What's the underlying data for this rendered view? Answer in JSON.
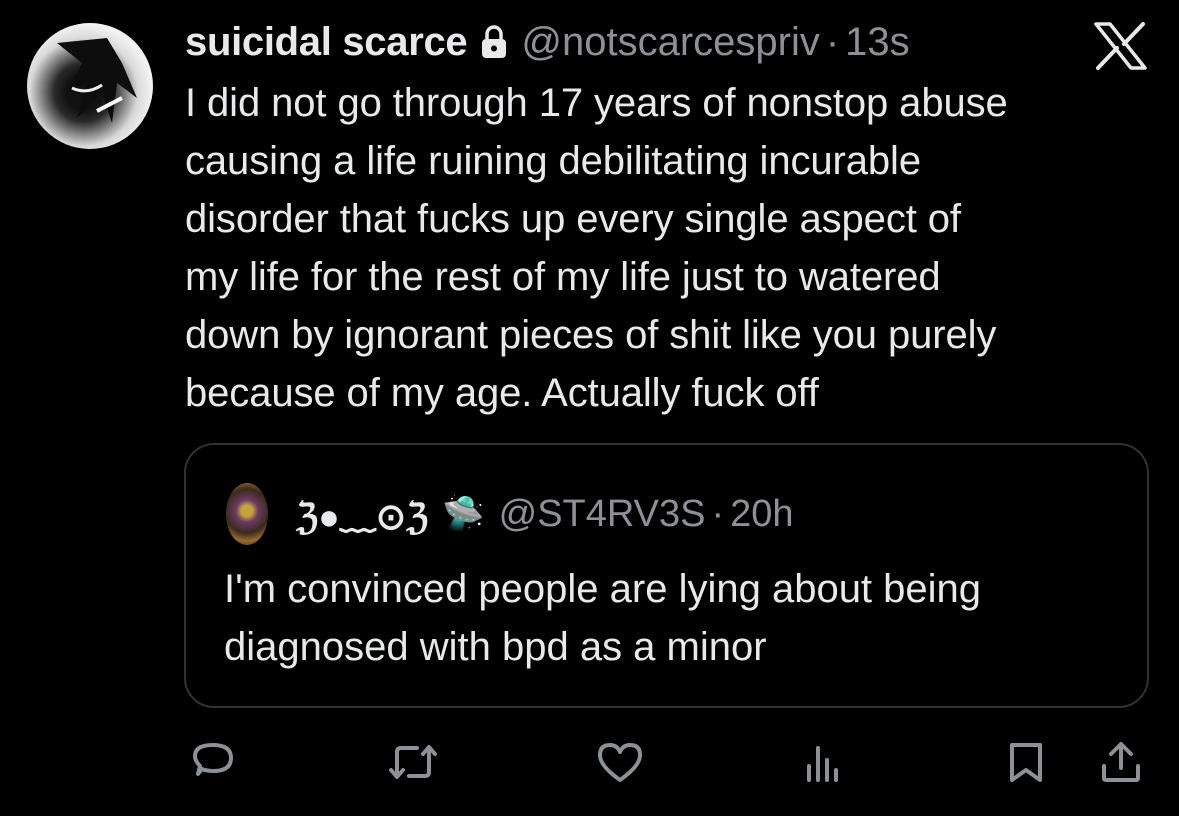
{
  "tweet": {
    "display_name": "suicidal scarce",
    "handle": "@notscarcespriv",
    "separator": "·",
    "time": "13s",
    "text": "I did not go through 17 years of nonstop abuse\ncausing a life ruining debilitating incurable\ndisorder that fucks up every single aspect of\nmy life for the rest of my life just to watered\ndown by ignorant pieces of shit like you purely\nbecause of my age. Actually fuck off"
  },
  "quote": {
    "display_name": "ℨ●﹏⊙ℨ",
    "emoji": "🛸",
    "handle": "@ST4RV3S",
    "separator": "·",
    "time": "20h",
    "text": "I'm convinced people are lying about being\ndiagnosed with bpd as a minor"
  },
  "icons": {
    "lock": "lock-icon",
    "x_logo": "x-logo-icon",
    "reply": "reply-icon",
    "repost": "repost-icon",
    "like": "heart-icon",
    "views": "views-icon",
    "bookmark": "bookmark-icon",
    "share": "share-icon"
  },
  "colors": {
    "background": "#000000",
    "text": "#e7e9ea",
    "muted": "#8b9196",
    "border": "#2f3336"
  }
}
